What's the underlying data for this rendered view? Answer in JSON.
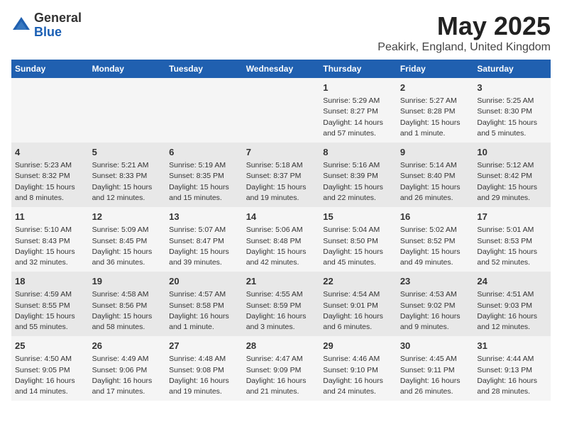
{
  "logo": {
    "general": "General",
    "blue": "Blue"
  },
  "title": "May 2025",
  "subtitle": "Peakirk, England, United Kingdom",
  "headers": [
    "Sunday",
    "Monday",
    "Tuesday",
    "Wednesday",
    "Thursday",
    "Friday",
    "Saturday"
  ],
  "weeks": [
    [
      {
        "day": "",
        "info": ""
      },
      {
        "day": "",
        "info": ""
      },
      {
        "day": "",
        "info": ""
      },
      {
        "day": "",
        "info": ""
      },
      {
        "day": "1",
        "info": "Sunrise: 5:29 AM\nSunset: 8:27 PM\nDaylight: 14 hours and 57 minutes."
      },
      {
        "day": "2",
        "info": "Sunrise: 5:27 AM\nSunset: 8:28 PM\nDaylight: 15 hours and 1 minute."
      },
      {
        "day": "3",
        "info": "Sunrise: 5:25 AM\nSunset: 8:30 PM\nDaylight: 15 hours and 5 minutes."
      }
    ],
    [
      {
        "day": "4",
        "info": "Sunrise: 5:23 AM\nSunset: 8:32 PM\nDaylight: 15 hours and 8 minutes."
      },
      {
        "day": "5",
        "info": "Sunrise: 5:21 AM\nSunset: 8:33 PM\nDaylight: 15 hours and 12 minutes."
      },
      {
        "day": "6",
        "info": "Sunrise: 5:19 AM\nSunset: 8:35 PM\nDaylight: 15 hours and 15 minutes."
      },
      {
        "day": "7",
        "info": "Sunrise: 5:18 AM\nSunset: 8:37 PM\nDaylight: 15 hours and 19 minutes."
      },
      {
        "day": "8",
        "info": "Sunrise: 5:16 AM\nSunset: 8:39 PM\nDaylight: 15 hours and 22 minutes."
      },
      {
        "day": "9",
        "info": "Sunrise: 5:14 AM\nSunset: 8:40 PM\nDaylight: 15 hours and 26 minutes."
      },
      {
        "day": "10",
        "info": "Sunrise: 5:12 AM\nSunset: 8:42 PM\nDaylight: 15 hours and 29 minutes."
      }
    ],
    [
      {
        "day": "11",
        "info": "Sunrise: 5:10 AM\nSunset: 8:43 PM\nDaylight: 15 hours and 32 minutes."
      },
      {
        "day": "12",
        "info": "Sunrise: 5:09 AM\nSunset: 8:45 PM\nDaylight: 15 hours and 36 minutes."
      },
      {
        "day": "13",
        "info": "Sunrise: 5:07 AM\nSunset: 8:47 PM\nDaylight: 15 hours and 39 minutes."
      },
      {
        "day": "14",
        "info": "Sunrise: 5:06 AM\nSunset: 8:48 PM\nDaylight: 15 hours and 42 minutes."
      },
      {
        "day": "15",
        "info": "Sunrise: 5:04 AM\nSunset: 8:50 PM\nDaylight: 15 hours and 45 minutes."
      },
      {
        "day": "16",
        "info": "Sunrise: 5:02 AM\nSunset: 8:52 PM\nDaylight: 15 hours and 49 minutes."
      },
      {
        "day": "17",
        "info": "Sunrise: 5:01 AM\nSunset: 8:53 PM\nDaylight: 15 hours and 52 minutes."
      }
    ],
    [
      {
        "day": "18",
        "info": "Sunrise: 4:59 AM\nSunset: 8:55 PM\nDaylight: 15 hours and 55 minutes."
      },
      {
        "day": "19",
        "info": "Sunrise: 4:58 AM\nSunset: 8:56 PM\nDaylight: 15 hours and 58 minutes."
      },
      {
        "day": "20",
        "info": "Sunrise: 4:57 AM\nSunset: 8:58 PM\nDaylight: 16 hours and 1 minute."
      },
      {
        "day": "21",
        "info": "Sunrise: 4:55 AM\nSunset: 8:59 PM\nDaylight: 16 hours and 3 minutes."
      },
      {
        "day": "22",
        "info": "Sunrise: 4:54 AM\nSunset: 9:01 PM\nDaylight: 16 hours and 6 minutes."
      },
      {
        "day": "23",
        "info": "Sunrise: 4:53 AM\nSunset: 9:02 PM\nDaylight: 16 hours and 9 minutes."
      },
      {
        "day": "24",
        "info": "Sunrise: 4:51 AM\nSunset: 9:03 PM\nDaylight: 16 hours and 12 minutes."
      }
    ],
    [
      {
        "day": "25",
        "info": "Sunrise: 4:50 AM\nSunset: 9:05 PM\nDaylight: 16 hours and 14 minutes."
      },
      {
        "day": "26",
        "info": "Sunrise: 4:49 AM\nSunset: 9:06 PM\nDaylight: 16 hours and 17 minutes."
      },
      {
        "day": "27",
        "info": "Sunrise: 4:48 AM\nSunset: 9:08 PM\nDaylight: 16 hours and 19 minutes."
      },
      {
        "day": "28",
        "info": "Sunrise: 4:47 AM\nSunset: 9:09 PM\nDaylight: 16 hours and 21 minutes."
      },
      {
        "day": "29",
        "info": "Sunrise: 4:46 AM\nSunset: 9:10 PM\nDaylight: 16 hours and 24 minutes."
      },
      {
        "day": "30",
        "info": "Sunrise: 4:45 AM\nSunset: 9:11 PM\nDaylight: 16 hours and 26 minutes."
      },
      {
        "day": "31",
        "info": "Sunrise: 4:44 AM\nSunset: 9:13 PM\nDaylight: 16 hours and 28 minutes."
      }
    ]
  ]
}
